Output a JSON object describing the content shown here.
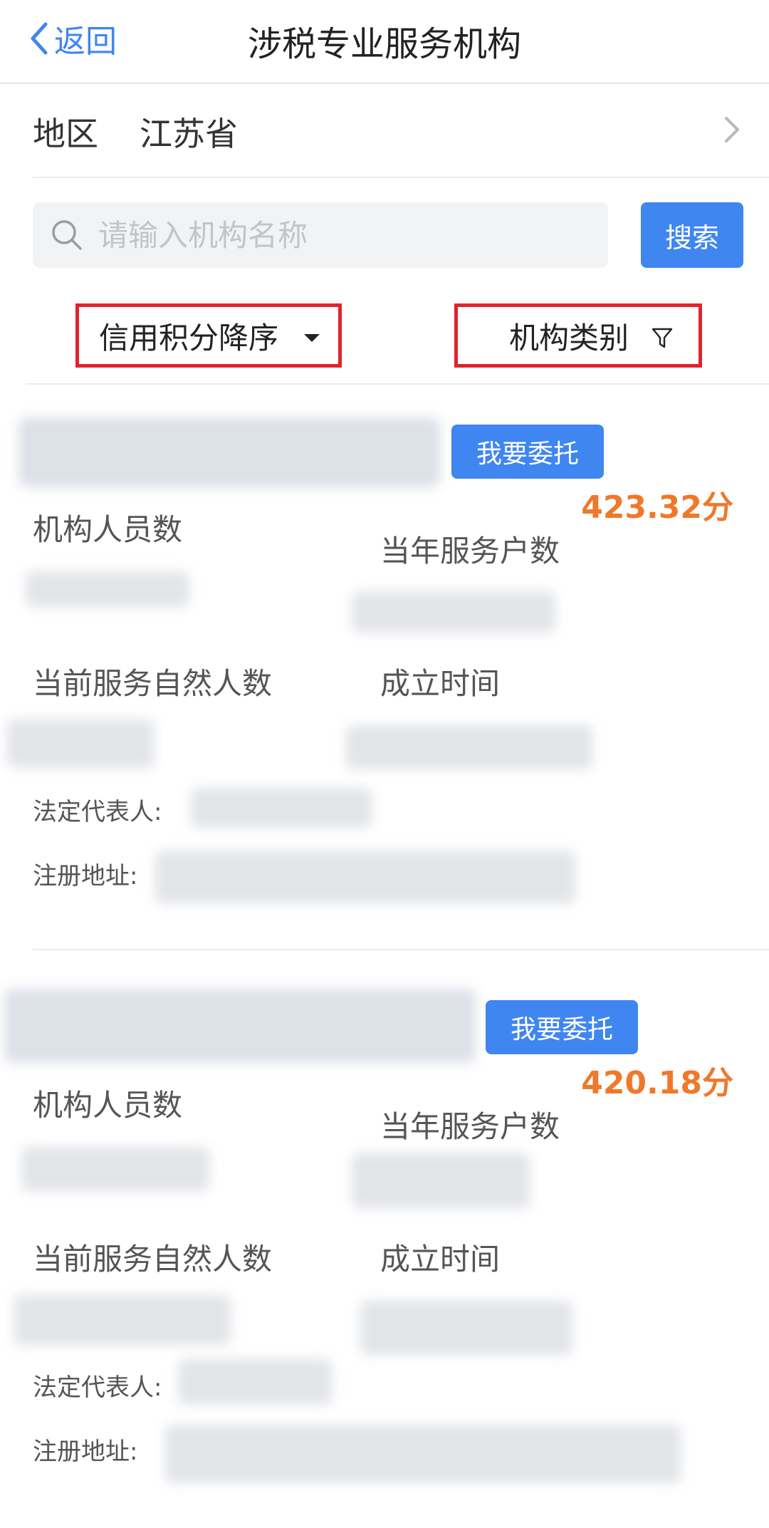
{
  "nav": {
    "back_label": "返回",
    "title": "涉税专业服务机构"
  },
  "region": {
    "label": "地区",
    "value": "江苏省"
  },
  "search": {
    "placeholder": "请输入机构名称",
    "button_label": "搜索"
  },
  "filters": {
    "sort_label": "信用积分降序",
    "category_label": "机构类别"
  },
  "colors": {
    "accent": "#3f86f0",
    "score": "#f0782a",
    "highlight_border": "#e0242c"
  },
  "labels": {
    "staff_count": "机构人员数",
    "households_this_year": "当年服务户数",
    "natural_persons": "当前服务自然人数",
    "established": "成立时间",
    "legal_rep": "法定代表人:",
    "address": "注册地址:"
  },
  "cards": [
    {
      "entrust_label": "我要委托",
      "score": "423.32分"
    },
    {
      "entrust_label": "我要委托",
      "score": "420.18分"
    }
  ]
}
